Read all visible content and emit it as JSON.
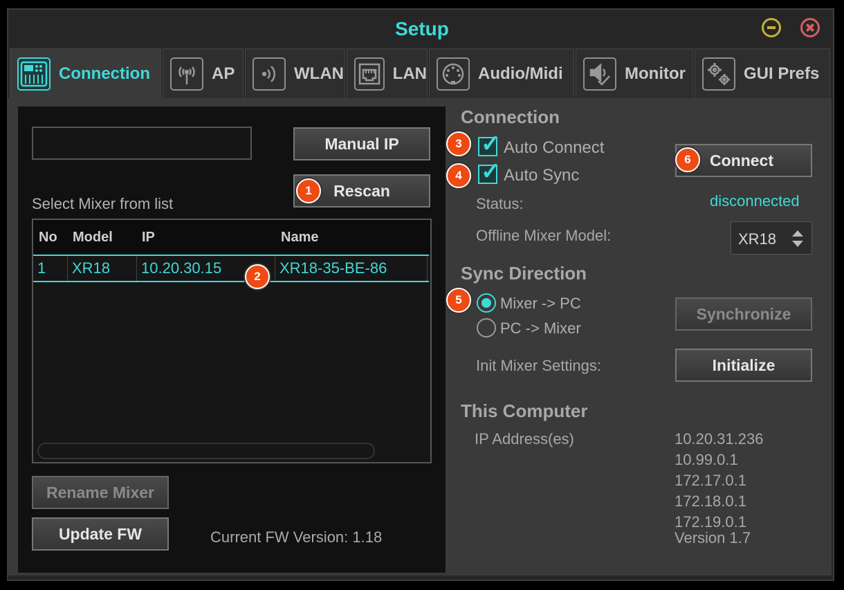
{
  "window": {
    "title": "Setup"
  },
  "tabs": [
    {
      "label": "Connection",
      "icon": "mixer-console-icon",
      "active": true
    },
    {
      "label": "AP",
      "icon": "antenna-icon"
    },
    {
      "label": "WLAN",
      "icon": "wifi-icon"
    },
    {
      "label": "LAN",
      "icon": "ethernet-port-icon"
    },
    {
      "label": "Audio/Midi",
      "icon": "midi-connector-icon"
    },
    {
      "label": "Monitor",
      "icon": "speaker-check-icon"
    },
    {
      "label": "GUI Prefs",
      "icon": "gears-icon"
    }
  ],
  "left": {
    "ip_value": "",
    "manual_ip_label": "Manual IP",
    "rescan_label": "Rescan",
    "select_label": "Select Mixer from list",
    "table": {
      "columns": [
        "No",
        "Model",
        "IP",
        "Name"
      ],
      "rows": [
        {
          "no": "1",
          "model": "XR18",
          "ip": "10.20.30.15",
          "name": "XR18-35-BE-86"
        }
      ]
    },
    "rename_label": "Rename Mixer",
    "update_fw_label": "Update FW",
    "fw_version_text": "Current FW Version: 1.18"
  },
  "right": {
    "connection_heading": "Connection",
    "auto_connect_label": "Auto Connect",
    "auto_sync_label": "Auto Sync",
    "connect_label": "Connect",
    "status_label": "Status:",
    "status_value": "disconnected",
    "offline_model_label": "Offline Mixer Model:",
    "offline_model_value": "XR18",
    "sync_heading": "Sync Direction",
    "mixer_to_pc": "Mixer -> PC",
    "pc_to_mixer": "PC -> Mixer",
    "synchronize_label": "Synchronize",
    "init_label": "Init Mixer Settings:",
    "initialize_label": "Initialize",
    "computer_heading": "This Computer",
    "ip_label": "IP Address(es)",
    "ips": [
      "10.20.31.236",
      "10.99.0.1",
      "172.17.0.1",
      "172.18.0.1",
      "172.19.0.1"
    ],
    "version": "Version 1.7"
  },
  "badges": [
    "1",
    "2",
    "3",
    "4",
    "5",
    "6"
  ],
  "colors": {
    "accent": "#3fd9d9",
    "badge": "#ee4a14",
    "background": "#262626"
  }
}
